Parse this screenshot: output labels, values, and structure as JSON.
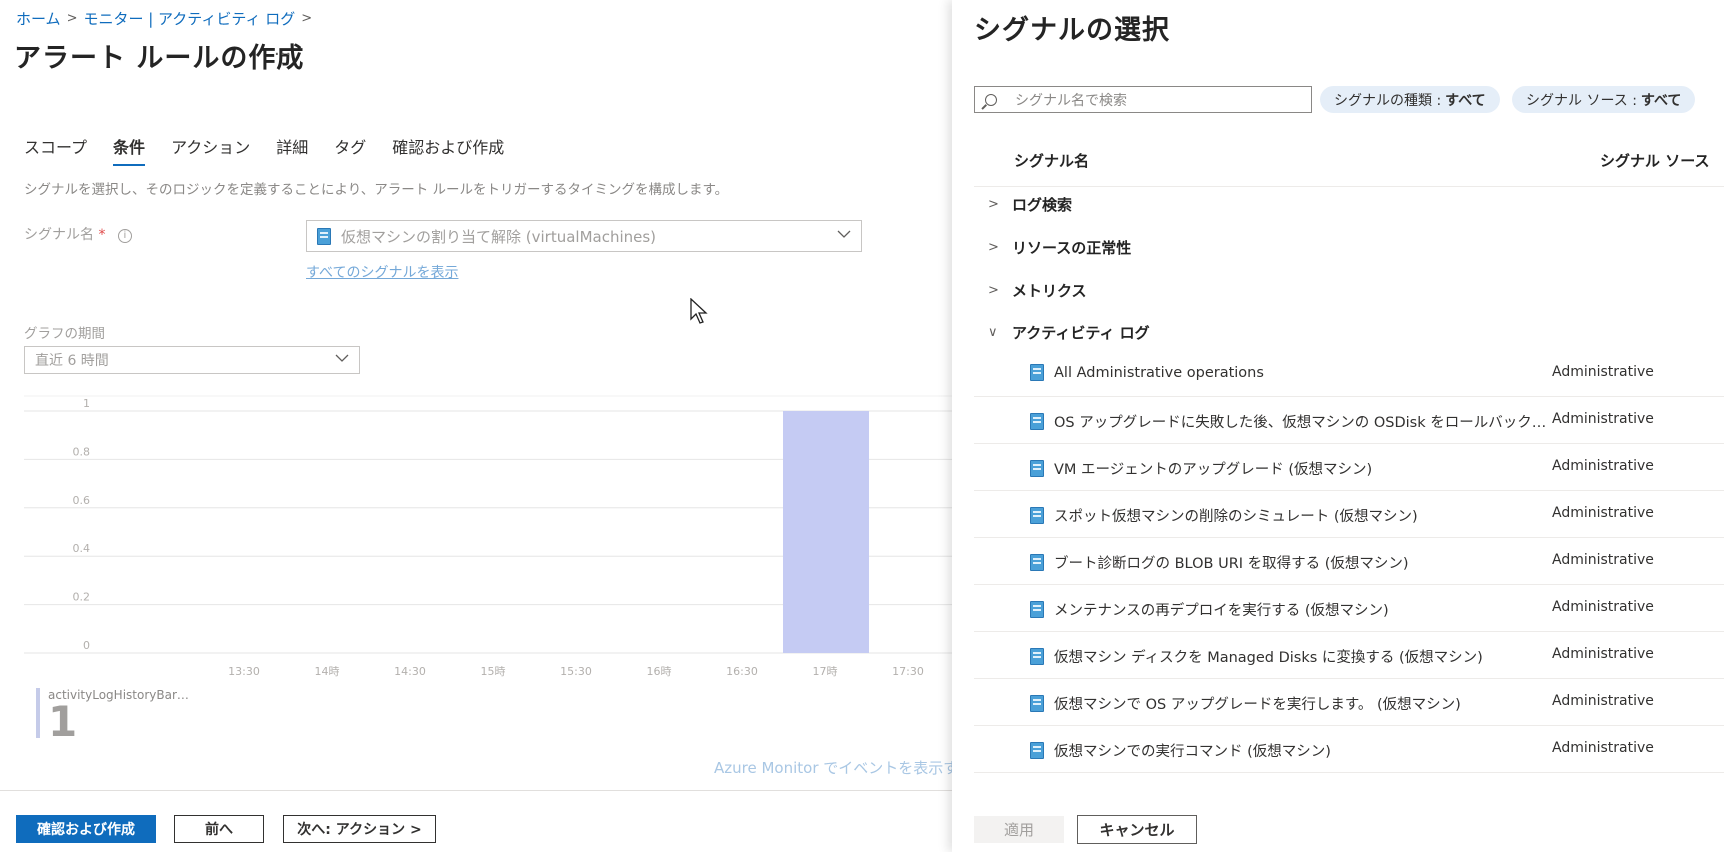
{
  "breadcrumb": {
    "home": "ホーム",
    "sep1": ">",
    "monitor": "モニター | アクティビティ ログ",
    "sep2": ">"
  },
  "page": {
    "title": "アラート ルールの作成",
    "more": "···"
  },
  "tabs": [
    {
      "label": "スコープ"
    },
    {
      "label": "条件"
    },
    {
      "label": "アクション"
    },
    {
      "label": "詳細"
    },
    {
      "label": "タグ"
    },
    {
      "label": "確認および作成"
    }
  ],
  "condition": {
    "description": "シグナルを選択し、そのロジックを定義することにより、アラート ルールをトリガーするタイミングを構成します。",
    "signal_label": "シグナル名",
    "required_mark": "*",
    "info": "i",
    "signal_value": "仮想マシンの割り当て解除 (virtualMachines)",
    "show_all_link": "すべてのシグナルを表示",
    "period_label": "グラフの期間",
    "period_value": "直近 6 時間"
  },
  "chart_data": {
    "type": "bar",
    "categories": [
      "13:30",
      "14時",
      "14:30",
      "15時",
      "15:30",
      "16時",
      "16:30",
      "17時",
      "17:30"
    ],
    "yticks": [
      "1",
      "0.8",
      "0.6",
      "0.4",
      "0.2",
      "0"
    ],
    "ylim": [
      0,
      1
    ],
    "bars": [
      {
        "x": "17時",
        "value": 1
      }
    ],
    "bar_color": "#c5cbf3",
    "grid": true
  },
  "summary": {
    "name": "activityLogHistoryBar…",
    "count": "1"
  },
  "azure_link": "Azure Monitor でイベントを表示する -",
  "footer": {
    "review_create": "確認および作成",
    "prev": "前へ",
    "next": "次へ: アクション >"
  },
  "panel": {
    "title": "シグナルの選択",
    "search_placeholder": "シグナル名で検索",
    "filter_type_label": "シグナルの種類 :",
    "filter_type_value": "すべて",
    "filter_source_label": "シグナル ソース :",
    "filter_source_value": "すべて",
    "col_name": "シグナル名",
    "col_source": "シグナル ソース",
    "groups": [
      {
        "label": "ログ検索",
        "caret": ">"
      },
      {
        "label": "リソースの正常性",
        "caret": ">"
      },
      {
        "label": "メトリクス",
        "caret": ">"
      },
      {
        "label": "アクティビティ ログ",
        "caret": "∨"
      }
    ],
    "rows": [
      {
        "label": "All Administrative operations",
        "source": "Administrative"
      },
      {
        "label": "OS アップグレードに失敗した後、仮想マシンの OSDisk をロールバックします。 (仮想マシン)",
        "source": "Administrative"
      },
      {
        "label": "VM エージェントのアップグレード (仮想マシン)",
        "source": "Administrative"
      },
      {
        "label": "スポット仮想マシンの削除のシミュレート (仮想マシン)",
        "source": "Administrative"
      },
      {
        "label": "ブート診断ログの BLOB URI を取得する (仮想マシン)",
        "source": "Administrative"
      },
      {
        "label": "メンテナンスの再デプロイを実行する (仮想マシン)",
        "source": "Administrative"
      },
      {
        "label": "仮想マシン ディスクを Managed Disks に変換する (仮想マシン)",
        "source": "Administrative"
      },
      {
        "label": "仮想マシンで OS アップグレードを実行します。 (仮想マシン)",
        "source": "Administrative"
      },
      {
        "label": "仮想マシンでの実行コマンド (仮想マシン)",
        "source": "Administrative"
      }
    ],
    "apply": "適用",
    "cancel": "キャンセル"
  }
}
